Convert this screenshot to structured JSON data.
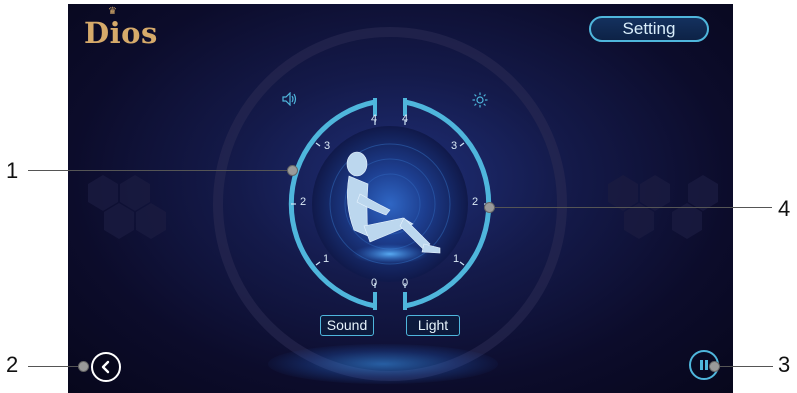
{
  "header": {
    "brand": "Dios",
    "setting_label": "Setting"
  },
  "dial": {
    "sound_ticks": [
      "0",
      "1",
      "2",
      "3",
      "4"
    ],
    "light_ticks": [
      "0",
      "1",
      "2",
      "3",
      "4"
    ],
    "sound_icon": "speaker-icon",
    "light_icon": "sun-icon"
  },
  "controls": {
    "sound_label": "Sound",
    "light_label": "Light",
    "back_icon": "chevron-left-icon",
    "pause_icon": "pause-icon"
  },
  "callouts": {
    "c1": "1",
    "c2": "2",
    "c3": "3",
    "c4": "4"
  },
  "colors": {
    "accent": "#4fb6dc",
    "brand": "#d6aa6a",
    "background": "#0c0c2b"
  }
}
